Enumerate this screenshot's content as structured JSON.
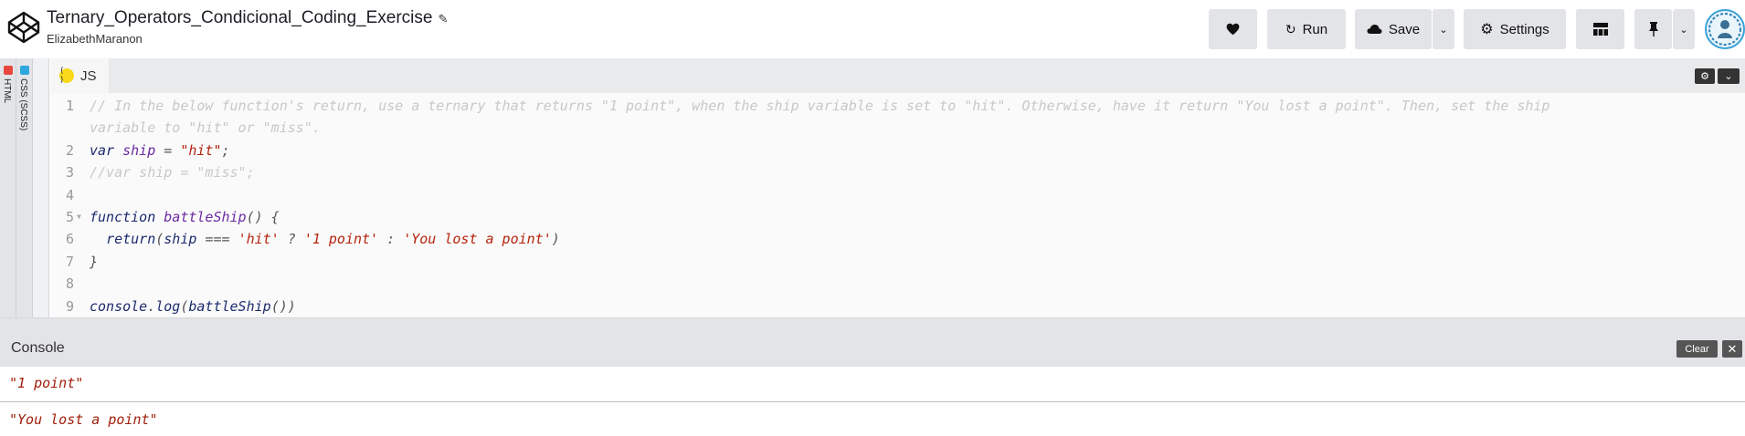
{
  "app": {
    "pen_title": "Ternary_Operators_Condicional_Coding_Exercise",
    "author": "ElizabethMaranon",
    "edit_icon": "pencil-icon"
  },
  "header": {
    "heart_icon": "heart-icon",
    "run_label": "Run",
    "save_label": "Save",
    "settings_label": "Settings",
    "layout_icon": "layout-grid-icon",
    "pin_icon": "pin-icon"
  },
  "side_panels": {
    "html_label": "HTML",
    "html_color": "#e8473c",
    "css_label": "CSS (SCSS)",
    "css_color": "#2fa7e0"
  },
  "editor": {
    "tab_label": "JS",
    "tab_icon": "js-babel-icon",
    "lines": [
      {
        "n": "1",
        "parts": [
          {
            "c": "com",
            "t": "// In the below function's return, use a ternary that returns \"1 point\", when the ship variable is set to \"hit\". Otherwise, have it return \"You lost a point\". Then, set the ship"
          }
        ]
      },
      {
        "n": "",
        "parts": [
          {
            "c": "com",
            "t": "variable to \"hit\" or \"miss\"."
          }
        ]
      },
      {
        "n": "2",
        "parts": [
          {
            "c": "kw",
            "t": "var "
          },
          {
            "c": "var",
            "t": "ship"
          },
          {
            "c": "pl",
            "t": " = "
          },
          {
            "c": "str",
            "t": "\"hit\""
          },
          {
            "c": "pl",
            "t": ";"
          }
        ]
      },
      {
        "n": "3",
        "parts": [
          {
            "c": "com",
            "t": "//var ship = \"miss\";"
          }
        ]
      },
      {
        "n": "4",
        "parts": []
      },
      {
        "n": "5",
        "fold": true,
        "parts": [
          {
            "c": "kw",
            "t": "function "
          },
          {
            "c": "fn",
            "t": "battleShip"
          },
          {
            "c": "pl",
            "t": "() {"
          }
        ]
      },
      {
        "n": "6",
        "parts": [
          {
            "c": "pl",
            "t": "  "
          },
          {
            "c": "kw",
            "t": "return"
          },
          {
            "c": "pl",
            "t": "("
          },
          {
            "c": "kw",
            "t": "ship"
          },
          {
            "c": "pl",
            "t": " === "
          },
          {
            "c": "str",
            "t": "'hit'"
          },
          {
            "c": "pl",
            "t": " ? "
          },
          {
            "c": "str",
            "t": "'1 point'"
          },
          {
            "c": "pl",
            "t": " : "
          },
          {
            "c": "str",
            "t": "'You lost a point'"
          },
          {
            "c": "pl",
            "t": ")"
          }
        ]
      },
      {
        "n": "7",
        "parts": [
          {
            "c": "pl",
            "t": "}"
          }
        ]
      },
      {
        "n": "8",
        "parts": []
      },
      {
        "n": "9",
        "parts": [
          {
            "c": "call",
            "t": "console"
          },
          {
            "c": "pl",
            "t": "."
          },
          {
            "c": "call",
            "t": "log"
          },
          {
            "c": "pl",
            "t": "("
          },
          {
            "c": "call",
            "t": "battleShip"
          },
          {
            "c": "pl",
            "t": "())"
          }
        ]
      }
    ]
  },
  "console": {
    "title": "Console",
    "clear_label": "Clear",
    "close_glyph": "✕",
    "output": [
      "\"1 point\"",
      "\"You lost a point\""
    ]
  }
}
